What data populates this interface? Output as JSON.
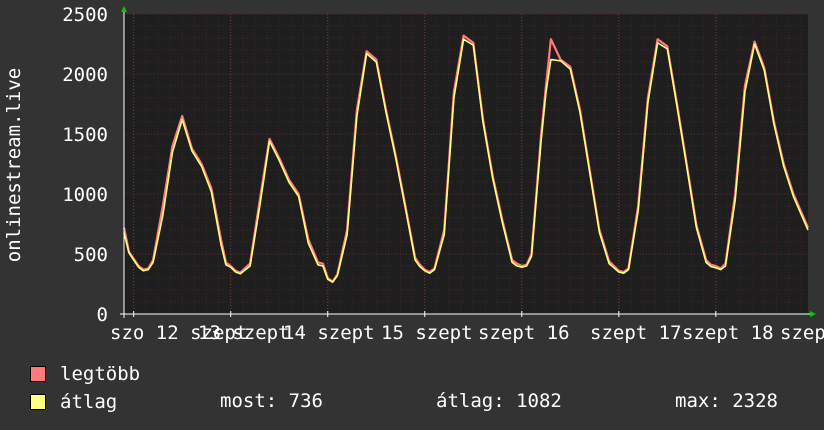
{
  "chart_data": {
    "type": "line",
    "ylabel": "onlinestream.live",
    "ylim": [
      0,
      2500
    ],
    "yticks": [
      0,
      500,
      1000,
      1500,
      2000,
      2500
    ],
    "xtick_labels": [
      "szo 12 szept",
      "13 szept",
      "14 szept",
      "15 szept",
      "szept 16",
      "szept 17",
      "szept 18",
      "szept"
    ],
    "grid": true,
    "colors": {
      "background": "#333333",
      "plot": "#1e1e1e",
      "grid": "#5a2a2a",
      "max": "#ff7b7b",
      "avg": "#ffff80",
      "axis": "#ffffff",
      "arrow": "#00cc00"
    },
    "x_start_day": 11.9,
    "x_end_day": 18.95,
    "series": [
      {
        "name": "legtöbb",
        "color": "#ff7b7b",
        "x": [
          11.9,
          11.95,
          12.0,
          12.05,
          12.1,
          12.15,
          12.2,
          12.3,
          12.4,
          12.5,
          12.6,
          12.7,
          12.8,
          12.9,
          12.95,
          13.0,
          13.05,
          13.1,
          13.2,
          13.3,
          13.4,
          13.5,
          13.6,
          13.7,
          13.8,
          13.9,
          13.95,
          14.0,
          14.05,
          14.1,
          14.2,
          14.3,
          14.4,
          14.5,
          14.6,
          14.7,
          14.8,
          14.9,
          14.95,
          15.0,
          15.05,
          15.1,
          15.2,
          15.3,
          15.4,
          15.5,
          15.6,
          15.7,
          15.8,
          15.9,
          15.95,
          16.0,
          16.05,
          16.1,
          16.2,
          16.25,
          16.3,
          16.4,
          16.5,
          16.6,
          16.7,
          16.8,
          16.9,
          16.95,
          17.0,
          17.05,
          17.1,
          17.2,
          17.3,
          17.4,
          17.5,
          17.6,
          17.7,
          17.8,
          17.9,
          17.95,
          18.0,
          18.05,
          18.1,
          18.2,
          18.3,
          18.4,
          18.5,
          18.6,
          18.7,
          18.8,
          18.95
        ],
        "y": [
          720,
          520,
          460,
          400,
          370,
          380,
          450,
          900,
          1400,
          1650,
          1380,
          1250,
          1050,
          620,
          430,
          400,
          360,
          345,
          420,
          950,
          1460,
          1300,
          1120,
          1000,
          620,
          430,
          420,
          300,
          270,
          330,
          700,
          1700,
          2190,
          2120,
          1700,
          1320,
          900,
          470,
          410,
          370,
          350,
          380,
          700,
          1850,
          2320,
          2260,
          1620,
          1150,
          780,
          450,
          420,
          400,
          410,
          500,
          1500,
          1900,
          2290,
          2120,
          2060,
          1700,
          1200,
          700,
          440,
          400,
          360,
          350,
          380,
          900,
          1800,
          2290,
          2230,
          1750,
          1250,
          740,
          450,
          410,
          400,
          380,
          420,
          1000,
          1900,
          2270,
          2050,
          1600,
          1250,
          1000,
          720
        ]
      },
      {
        "name": "átlag",
        "color": "#ffff80",
        "x": [
          11.9,
          11.95,
          12.0,
          12.05,
          12.1,
          12.15,
          12.2,
          12.3,
          12.4,
          12.5,
          12.6,
          12.7,
          12.8,
          12.9,
          12.95,
          13.0,
          13.05,
          13.1,
          13.2,
          13.3,
          13.4,
          13.5,
          13.6,
          13.7,
          13.8,
          13.9,
          13.95,
          14.0,
          14.05,
          14.1,
          14.2,
          14.3,
          14.4,
          14.5,
          14.6,
          14.7,
          14.8,
          14.9,
          14.95,
          15.0,
          15.05,
          15.1,
          15.2,
          15.3,
          15.4,
          15.5,
          15.6,
          15.7,
          15.8,
          15.9,
          15.95,
          16.0,
          16.05,
          16.1,
          16.2,
          16.25,
          16.3,
          16.4,
          16.5,
          16.6,
          16.7,
          16.8,
          16.9,
          16.95,
          17.0,
          17.05,
          17.1,
          17.2,
          17.3,
          17.4,
          17.5,
          17.6,
          17.7,
          17.8,
          17.9,
          17.95,
          18.0,
          18.05,
          18.1,
          18.2,
          18.3,
          18.4,
          18.5,
          18.6,
          18.7,
          18.8,
          18.95
        ],
        "y": [
          680,
          510,
          450,
          390,
          360,
          370,
          430,
          820,
          1350,
          1620,
          1360,
          1230,
          1020,
          580,
          410,
          390,
          350,
          335,
          400,
          900,
          1440,
          1280,
          1100,
          980,
          590,
          410,
          400,
          290,
          265,
          320,
          660,
          1650,
          2170,
          2100,
          1680,
          1300,
          880,
          450,
          395,
          360,
          340,
          370,
          660,
          1800,
          2290,
          2240,
          1600,
          1130,
          760,
          430,
          400,
          390,
          400,
          480,
          1450,
          1850,
          2120,
          2110,
          2040,
          1680,
          1180,
          680,
          420,
          385,
          350,
          340,
          370,
          860,
          1760,
          2260,
          2210,
          1730,
          1230,
          720,
          430,
          395,
          385,
          370,
          400,
          950,
          1850,
          2250,
          2030,
          1580,
          1230,
          980,
          700
        ]
      }
    ]
  },
  "legend": [
    {
      "label": "legtöbb",
      "color": "#ff7b7b"
    },
    {
      "label": "átlag",
      "color": "#ffff80"
    }
  ],
  "stats": {
    "most": "most: 736",
    "atlag": "átlag: 1082",
    "max": "max: 2328"
  }
}
